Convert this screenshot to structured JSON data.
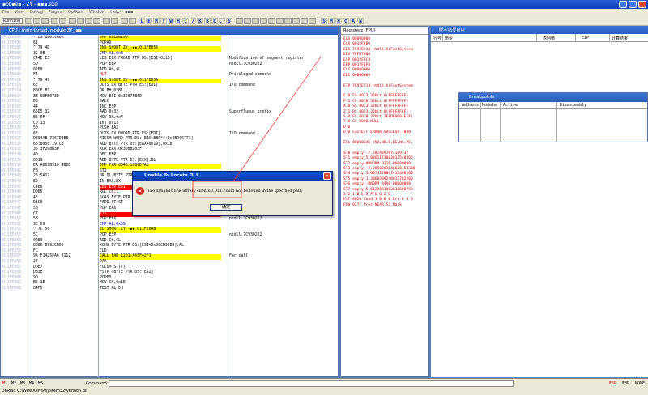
{
  "app": {
    "title": "▪ob▪e▪ - ZY - ▪▪▪.exe"
  },
  "menu": [
    "File",
    "View",
    "Debug",
    "Plugins",
    "Options",
    "Window",
    "Help",
    "▪▪▪"
  ],
  "toolbar": {
    "status": "Running",
    "letters": [
      "L",
      "E",
      "M",
      "T",
      "W",
      "H",
      "C",
      "/",
      "K",
      "B",
      "R",
      "...",
      "S"
    ],
    "letters2": [
      "S",
      "M",
      "H",
      "O",
      "A",
      "N"
    ]
  },
  "cpu": {
    "title": "CPU - main thread, module ZY_-▪▪"
  },
  "disasm": [
    {
      "a": "011FE000",
      "h": "- E9 8BD1CA6D",
      "i": "JMP 6EEAB190",
      "cls": "yel"
    },
    {
      "a": "011FE005",
      "h": "61",
      "i": "POPAD"
    },
    {
      "a": "011FE006",
      "h": "^ 79 4D",
      "i": "JNS SHORT ZY_-▪▪.011FE055",
      "cls": "yel"
    },
    {
      "a": "011FE008",
      "h": "3C 0B",
      "i": "CMP AL,0xB",
      "cls": "blue"
    },
    {
      "a": "011FE00A",
      "h": "C44E E5",
      "i": "LES ECX,FWORD PTR DS:[ESI-0x1B]",
      "c": "Modification of segment register"
    },
    {
      "a": "011FE00D",
      "h": "5D",
      "i": "POP EBP",
      "c": "ntdll.7C930222"
    },
    {
      "a": "011FE00E",
      "h": "02E0",
      "i": "ADD AH,AL"
    },
    {
      "a": "011FE010",
      "h": "F4",
      "i": "HLT",
      "cls": "red",
      "c": "Privileged command"
    },
    {
      "a": "011FE011",
      "h": "^ 79 47",
      "i": "JNS SHORT ZY_-▪▪.011FE05A",
      "cls": "yel"
    },
    {
      "a": "011FE013",
      "h": "6E",
      "i": "OUTS DX,BYTE PTR ES:[EDI]",
      "c": "I/O command"
    },
    {
      "a": "011FE014",
      "h": "80CF B1",
      "i": "OR BH,0xB1"
    },
    {
      "a": "011FE017",
      "h": "8B 6DFB073D",
      "i": "MOV ESI,0x3D07FB6D"
    },
    {
      "a": "011FE01C",
      "h": "D6",
      "i": "SALC"
    },
    {
      "a": "011FE01D",
      "h": "44",
      "i": "INC ESP"
    },
    {
      "a": "011FE01E",
      "h": "65D5 32",
      "i": "AAD 0x32",
      "c": "Superfluous prefix"
    },
    {
      "a": "011FE021",
      "h": "B6 0F",
      "i": "MOV DH,0xF"
    },
    {
      "a": "011FE023",
      "h": "CD 13",
      "i": "INT 0x13"
    },
    {
      "a": "011FE025",
      "h": "50",
      "i": "PUSH EAX"
    },
    {
      "a": "011FE026",
      "h": "6F",
      "i": "OUTS DX,DWORD PTR ES:[EDI]",
      "c": "I/O command"
    },
    {
      "a": "011FE027",
      "h": "DE94AB 7367D0EB",
      "i": "FICOM WORD PTR DS:[EBX+EBP*4+0xEBD06773]"
    },
    {
      "a": "011FE02E",
      "h": "66:8050 19 C8",
      "i": "ADD BYTE PTR DS:[EAX+0x19],0xC8"
    },
    {
      "a": "011FE033",
      "h": "35 3F208B3D",
      "i": "XOR EAX,0x3D8B203F"
    },
    {
      "a": "011FE038",
      "h": "4D",
      "i": "DEC EBP"
    },
    {
      "a": "011FE039",
      "h": "0019",
      "i": "ADD BYTE PTR DS:[ECX],BL"
    },
    {
      "a": "011FE03B",
      "h": "EA A0D7B910 4B0D",
      "i": "JMP FAR 0D4B:10B9D7A0",
      "cls": "yel"
    },
    {
      "a": "011FE042",
      "h": "FB",
      "i": "STI"
    },
    {
      "a": "011FE043",
      "h": "26:5A17",
      "i": "OR DL,BYTE PTR ES:[EDI]"
    },
    {
      "a": "011FE046",
      "h": "ED",
      "i": "IN EAX,DX"
    },
    {
      "a": "011FE047",
      "h": "C4E6",
      "i": "LES ESP,ESI",
      "cls": "redbg"
    },
    {
      "a": "011FE049",
      "h": "D0D5",
      "i": "RCL CH,1"
    },
    {
      "a": "011FE04B",
      "h": "AE",
      "i": "SCAS BYTE PTR ES:[EDI]"
    },
    {
      "a": "011FE04C",
      "h": "D8C0",
      "i": "FADD ST,ST"
    },
    {
      "a": "011FE04E",
      "h": "58",
      "i": "POP EAX",
      "c": "ntdll.7C930222"
    },
    {
      "a": "011FE04F",
      "h": "C7",
      "i": "???",
      "cls": "redbg",
      "c": "Unknown command"
    },
    {
      "a": "011FE050",
      "h": "5B",
      "i": "POP EBX",
      "c": "ntdll.7C930222"
    },
    {
      "a": "011FE051",
      "h": "3C 59",
      "i": "CMP AL,0x59",
      "cls": "blue"
    },
    {
      "a": "011FE053",
      "h": "^ 7C 56",
      "i": "JL SHORT ZY_-▪▪.011FE0AB",
      "cls": "yel"
    },
    {
      "a": "011FE055",
      "h": "5C",
      "i": "POP ESP",
      "c": "ntdll.7C930222"
    },
    {
      "a": "011FE056",
      "h": "02E9",
      "i": "ADD CH,CL"
    },
    {
      "a": "011FE058",
      "h": "8686 B992CB66",
      "i": "XCHG BYTE PTR DS:[ESI+0x66CB92B9],AL"
    },
    {
      "a": "011FE05E",
      "h": "FC",
      "i": "CLD"
    },
    {
      "a": "011FE05F",
      "h": "9A F1425FA6 0112",
      "i": "CALL FAR 1201:A65F42F1",
      "cls": "yel",
      "c": "Far call"
    },
    {
      "a": "011FE066",
      "h": "27",
      "i": "DAA"
    },
    {
      "a": "011FE067",
      "h": "DDE7",
      "i": "FUCOM ST(7)"
    },
    {
      "a": "011FE069",
      "h": "DB3E",
      "i": "FSTP TBYTE PTR DS:[ESI]"
    },
    {
      "a": "011FE06B",
      "h": "9D",
      "i": "POPFD"
    },
    {
      "a": "011FE06C",
      "h": "B5 1E",
      "i": "MOV CH,0x1E"
    },
    {
      "a": "011FE06E",
      "h": "84F5",
      "i": "TEST AL,DH"
    }
  ],
  "regs": {
    "title": "Registers (FPU)",
    "lines": [
      "EAX 00000000",
      "ECX 0012FFB0",
      "EDX 7C92E514 ntdll.KiFastSystem",
      "EBX 7FFD7000",
      "ESP 0012FFC4",
      "EBP 0012FFF0",
      "ESI 00000000",
      "EDI 00000000",
      "",
      "EIP 7C92E514 ntdll.KiFastSystem",
      "",
      "C 0  ES 0023 32bit 0(FFFFFFFF)",
      "P 1  CS 001B 32bit 0(FFFFFFFF)",
      "A 0  SS 0023 32bit 0(FFFFFFFF)",
      "Z 1  DS 0023 32bit 0(FFFFFFFF)",
      "S 0  FS 003B 32bit 7FFDF000(FFF)",
      "T 0  GS 0000 NULL",
      "D 0",
      "O 0  LastErr ERROR_SUCCESS (000",
      "",
      "EFL 00000246 (NO,NB,E,BE,NS,PE,",
      "",
      "ST0 empty -7.2874397074189137",
      "ST1 empty 5.0361173083632548865",
      "ST2 empty #UNORM 0216 00000000",
      "ST3 empty -2.2650263846628450336",
      "ST4 empty 5.6074228067415406160",
      "ST5 empty 1.3860399248017782280",
      "ST6 empty -UNORM 94A0 00000000",
      "ST7 empty 5.6129883063636680758",
      "      3 2 1 0   E S P U O Z D",
      "FST 4020  Cond 1 0 0 0  Err 0 0 0",
      "FCW 027F  Prec NEAR,53  Mask"
    ]
  },
  "script": {
    "title": "脚本运行窗口",
    "cols": [
      "行号",
      "命令",
      "返回值",
      "EIP",
      "计算结果"
    ]
  },
  "breakpoints": {
    "title": "Breakpoints",
    "cols": [
      "Address",
      "Module",
      "Active",
      "Disassembly"
    ]
  },
  "dialog": {
    "title": "Unable To Locate DLL",
    "message": "The dynamic link library clientdll.DLL could not be found in the specified path",
    "ok": "确定",
    "icon": "error-icon"
  },
  "bottom": {
    "m": [
      "M1",
      "M2",
      "M3",
      "M4",
      "M5"
    ],
    "cmd_label": "Command:",
    "right": [
      "ESP",
      "EBP",
      "NONE"
    ],
    "status": "Unload C:\\WINDOWS\\system32\\version.dll"
  }
}
